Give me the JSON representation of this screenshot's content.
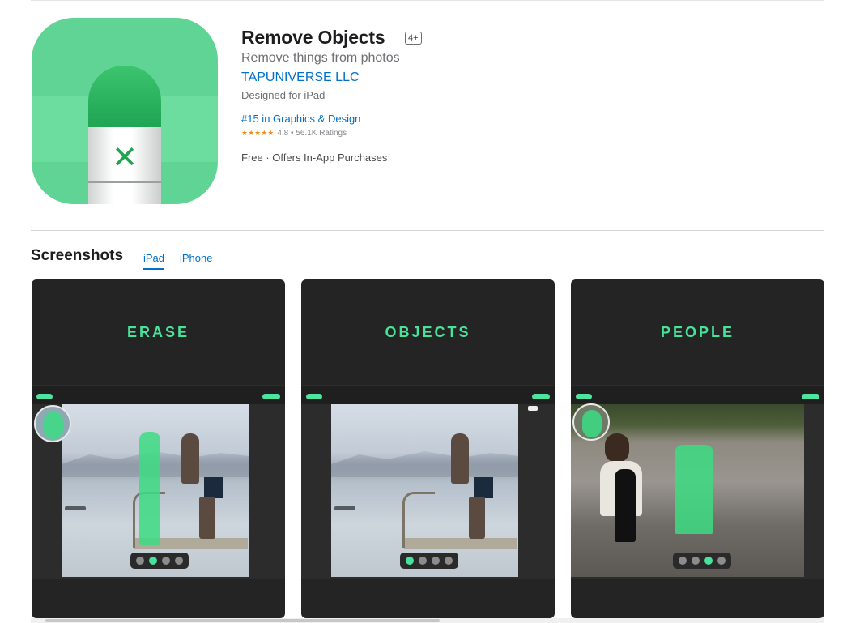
{
  "app": {
    "title": "Remove Objects",
    "age_rating": "4+",
    "subtitle": "Remove things from photos",
    "developer": "TAPUNIVERSE LLC",
    "designed_for": "Designed for iPad",
    "rank": "#15 in Graphics & Design",
    "stars": "★★★★★",
    "rating_summary": "4.8 • 56.1K Ratings",
    "price": "Free · Offers In-App Purchases",
    "icon": "eraser-icon",
    "icon_mark": "✕"
  },
  "screenshots": {
    "title": "Screenshots",
    "tabs": [
      {
        "label": "iPad",
        "active": true
      },
      {
        "label": "iPhone",
        "active": false
      }
    ],
    "cards": [
      {
        "heading": "ERASE"
      },
      {
        "heading": "OBJECTS"
      },
      {
        "heading": "PEOPLE"
      }
    ]
  },
  "colors": {
    "accent_link": "#0070c9",
    "stars": "#f08e1a",
    "app_green": "#48e29a"
  }
}
